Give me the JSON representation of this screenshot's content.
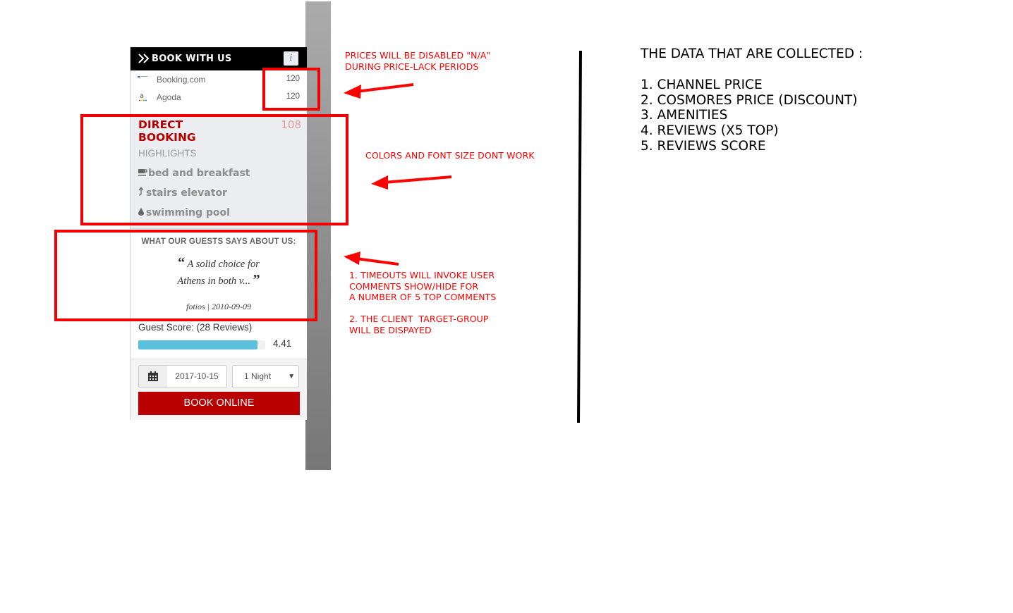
{
  "widget": {
    "header_title": "BOOK WITH US",
    "info_label": "i",
    "channels": [
      {
        "name": "Booking.com",
        "price": "120",
        "icon": "booking-logo-icon"
      },
      {
        "name": "Agoda",
        "price": "120",
        "icon": "agoda-logo-icon"
      }
    ],
    "direct": {
      "title_line1": "DIRECT",
      "title_line2": "BOOKING",
      "price": "108",
      "highlights_label": "HIGHLIGHTS",
      "amenities": [
        {
          "label": "bed and breakfast",
          "icon": "coffee-cup-icon"
        },
        {
          "label": "stairs elevator",
          "icon": "arrow-up-icon"
        },
        {
          "label": "swimming pool",
          "icon": "water-drop-icon"
        }
      ]
    },
    "reviews": {
      "heading": "WHAT OUR GUESTS SAYS ABOUT US:",
      "open_quote": "“",
      "close_quote": "”",
      "quote_line1": "A solid choice for",
      "quote_line2": "Athens in both v...",
      "author": "fotios | 2010-09-09"
    },
    "score": {
      "label": "Guest Score: (28 Reviews)",
      "value": "4.41",
      "fill_fraction": 0.94
    },
    "booking": {
      "date": "2017-10-15",
      "nights": "1 Night",
      "button": "BOOK ONLINE"
    }
  },
  "annotations": {
    "prices_note": "PRICES WILL BE DISABLED \"N/A\"\nDURING PRICE-LACK PERIODS",
    "colors_note": "COLORS AND FONT SIZE DONT WORK",
    "timeouts_note": "1. TIMEOUTS WILL INVOKE USER\nCOMMENTS SHOW/HIDE FOR\nA NUMBER OF 5 TOP COMMENTS\n\n2. THE CLIENT  TARGET-GROUP\nWILL BE DISPAYED"
  },
  "data_panel": {
    "heading": "THE DATA THAT ARE COLLECTED :",
    "items": [
      "1. CHANNEL PRICE",
      "2. COSMORES PRICE (DISCOUNT)",
      "3. AMENITIES",
      "4. REVIEWS (X5 TOP)",
      "5. REVIEWS SCORE"
    ]
  },
  "colors": {
    "brand_red": "#b80000",
    "annotation_red": "#f00000",
    "score_bar": "#5bc0de"
  }
}
